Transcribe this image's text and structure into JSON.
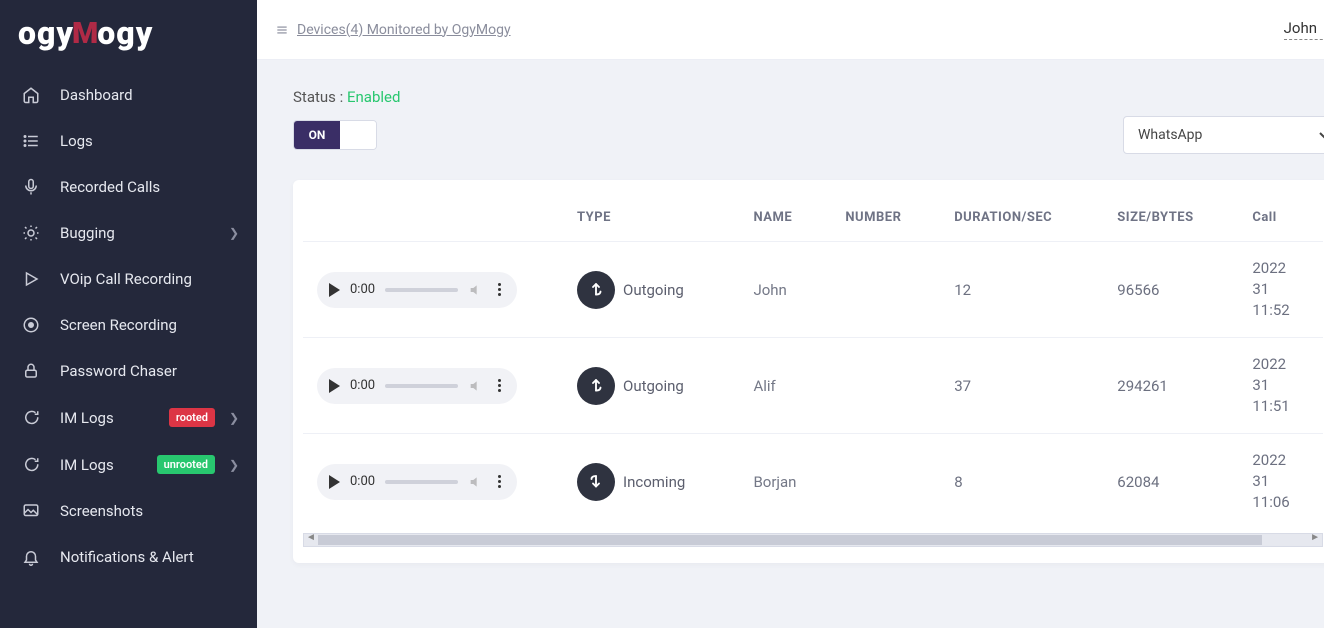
{
  "brand": {
    "part1": "ogy",
    "part2": "ogy"
  },
  "sidebar": {
    "items": [
      {
        "label": "Dashboard"
      },
      {
        "label": "Logs"
      },
      {
        "label": "Recorded Calls"
      },
      {
        "label": "Bugging"
      },
      {
        "label": "VOip Call Recording"
      },
      {
        "label": "Screen Recording"
      },
      {
        "label": "Password Chaser"
      },
      {
        "label": "IM Logs",
        "badge": "rooted"
      },
      {
        "label": "IM Logs",
        "badge": "unrooted"
      },
      {
        "label": "Screenshots"
      },
      {
        "label": "Notifications & Alert"
      }
    ]
  },
  "header": {
    "breadcrumb": "Devices(4) Monitored by OgyMogy",
    "user": "John"
  },
  "status": {
    "label": "Status :",
    "value": "Enabled",
    "toggle": "ON"
  },
  "filter": {
    "selected": "WhatsApp"
  },
  "table": {
    "headers": [
      "TYPE",
      "NAME",
      "NUMBER",
      "DURATION/SEC",
      "SIZE/BYTES",
      "Call"
    ],
    "rows": [
      {
        "audio_time": "0:00",
        "type": "Outgoing",
        "name": "John",
        "number": "",
        "duration": "12",
        "size": "96566",
        "date_l1": "2022",
        "date_l2": "31",
        "date_l3": "11:52"
      },
      {
        "audio_time": "0:00",
        "type": "Outgoing",
        "name": "Alif",
        "number": "",
        "duration": "37",
        "size": "294261",
        "date_l1": "2022",
        "date_l2": "31",
        "date_l3": "11:51"
      },
      {
        "audio_time": "0:00",
        "type": "Incoming",
        "name": "Borjan",
        "number": "",
        "duration": "8",
        "size": "62084",
        "date_l1": "2022",
        "date_l2": "31",
        "date_l3": "11:06"
      }
    ]
  }
}
